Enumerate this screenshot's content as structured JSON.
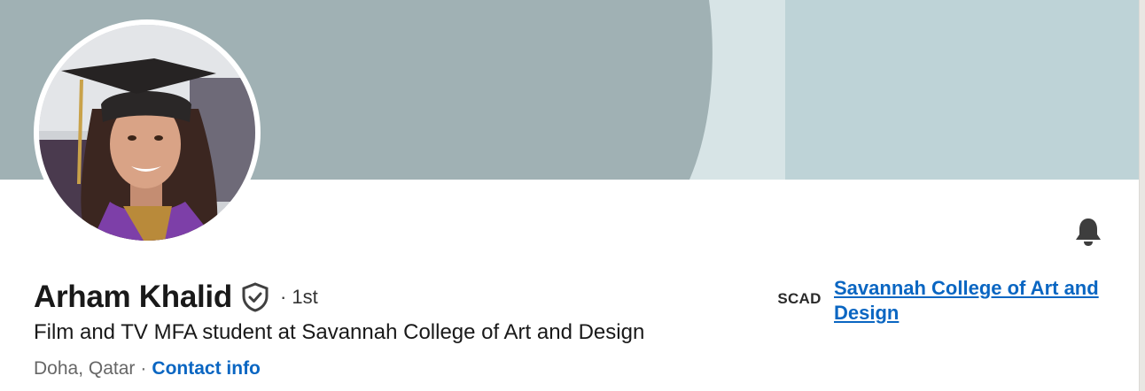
{
  "profile": {
    "name": "Arham Khalid",
    "degree": "· 1st",
    "headline": "Film and TV MFA student at Savannah College of Art and Design",
    "location": "Doha, Qatar",
    "separator": "·",
    "contact_label": "Contact info"
  },
  "organization": {
    "logo_text": "SCAD",
    "name": "Savannah College of Art and Design"
  },
  "icons": {
    "verified": "verified-shield-icon",
    "notifications": "bell-icon"
  },
  "colors": {
    "link": "#0a66c2",
    "banner_primary": "#a0b1b4",
    "banner_light": "#bed3d7"
  }
}
